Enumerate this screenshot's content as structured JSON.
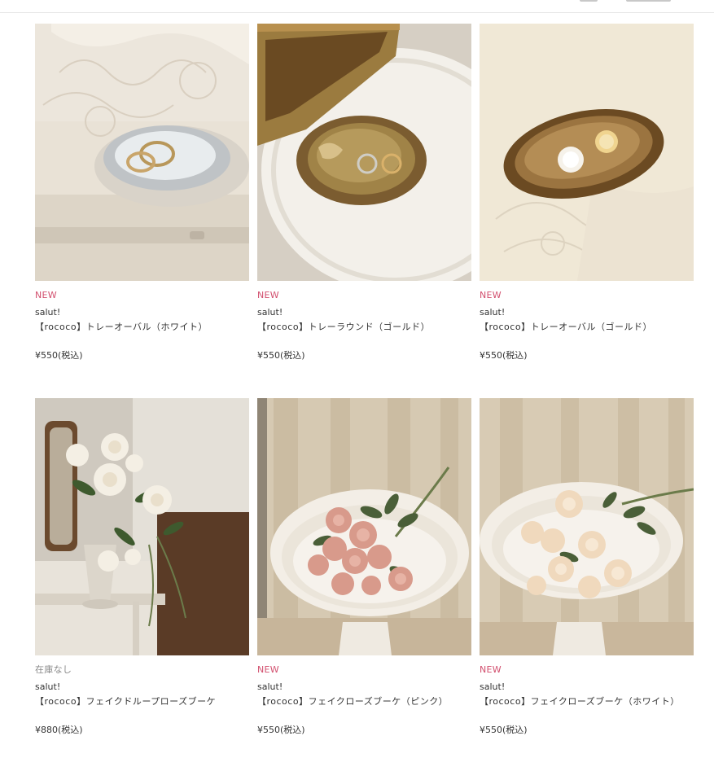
{
  "products": [
    {
      "label": "NEW",
      "label_type": "new",
      "brand": "salut!",
      "name": "【rococo】トレーオーバル（ホワイト）",
      "price": "¥550(税込)",
      "image": "white-oval-mirror-tray-with-rings"
    },
    {
      "label": "NEW",
      "label_type": "new",
      "brand": "salut!",
      "name": "【rococo】トレーラウンド（ゴールド）",
      "price": "¥550(税込)",
      "image": "gold-round-tray-with-rings"
    },
    {
      "label": "NEW",
      "label_type": "new",
      "brand": "salut!",
      "name": "【rococo】トレーオーバル（ゴールド）",
      "price": "¥550(税込)",
      "image": "gold-oval-tray-with-rings"
    },
    {
      "label": "在庫なし",
      "label_type": "soldout",
      "brand": "salut!",
      "name": "【rococo】フェイクドループローズブーケ",
      "price": "¥880(税込)",
      "image": "white-drooping-rose-bouquet-in-vase"
    },
    {
      "label": "NEW",
      "label_type": "new",
      "brand": "salut!",
      "name": "【rococo】フェイクローズブーケ（ピンク）",
      "price": "¥550(税込)",
      "image": "pink-rose-bouquet-on-cake-stand"
    },
    {
      "label": "NEW",
      "label_type": "new",
      "brand": "salut!",
      "name": "【rococo】フェイクローズブーケ（ホワイト）",
      "price": "¥550(税込)",
      "image": "white-rose-bouquet-on-cake-stand"
    }
  ],
  "colors": {
    "new_label": "#d24f6e",
    "soldout_label": "#888888",
    "text": "#333333"
  }
}
